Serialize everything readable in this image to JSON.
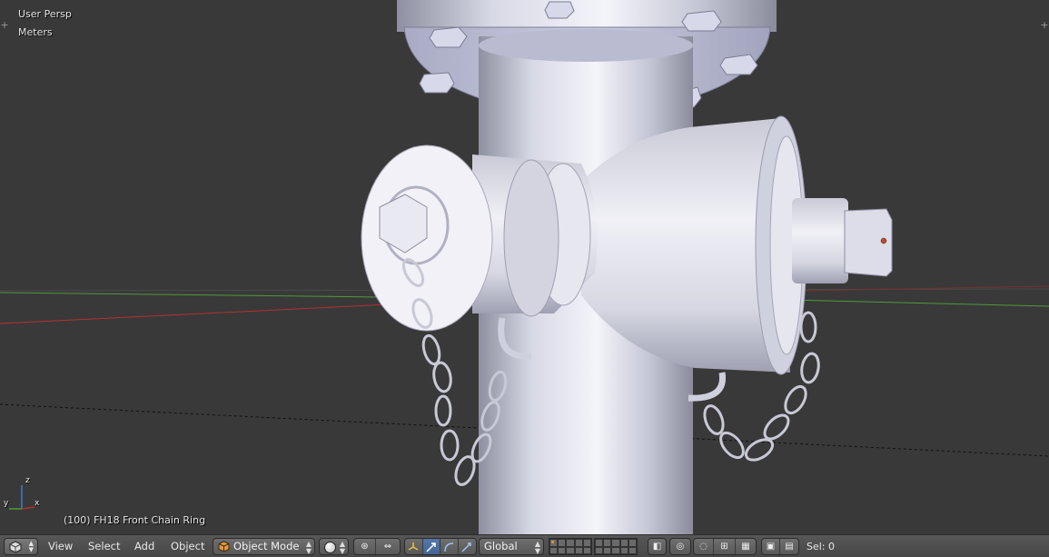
{
  "viewport": {
    "view_name": "User Persp",
    "units": "Meters",
    "object_info": "(100) FH18 Front Chain Ring",
    "axes": {
      "x": "x",
      "y": "y",
      "z": "z"
    }
  },
  "header": {
    "editor_type_icon": "3d-view-icon",
    "menus": [
      "View",
      "Select",
      "Add",
      "Object"
    ],
    "mode": {
      "label": "Object Mode",
      "icon": "object-cube-icon"
    },
    "shading_icon": "solid-sphere-icon",
    "pivot_icon": "pivot-point-icon",
    "manipulator_icons": [
      "manipulator-toggle-icon",
      "translate-icon",
      "rotate-icon",
      "scale-icon"
    ],
    "orientation": "Global",
    "layer_count": 20,
    "selection": "Sel: 0"
  },
  "colors": {
    "viewport_bg": "#393939",
    "header_bg": "#505050",
    "x_axis": "#b33232",
    "y_axis": "#4f9a3a",
    "mesh": "#d9dae8"
  }
}
